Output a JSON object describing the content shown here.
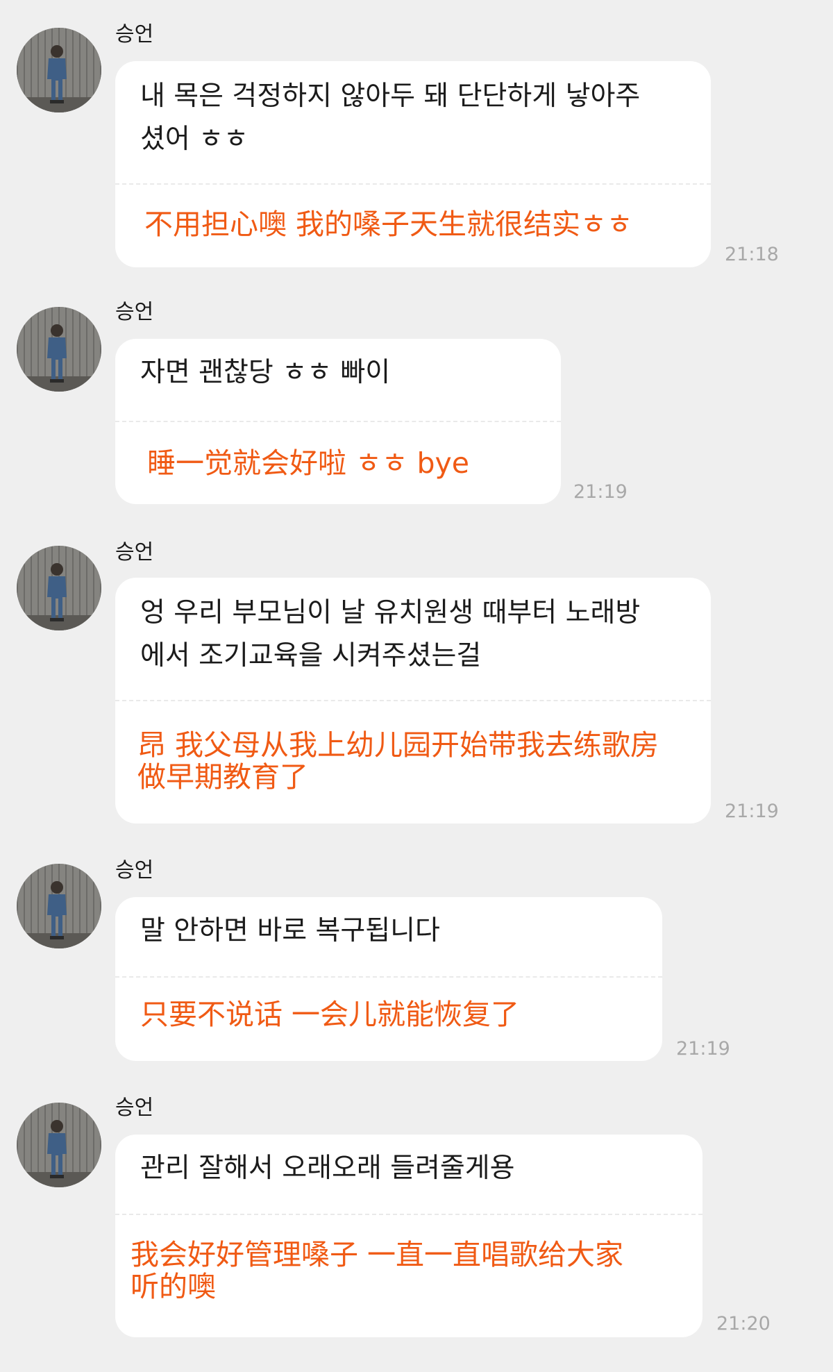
{
  "colors": {
    "background": "#efefef",
    "bubble": "#ffffff",
    "original_text": "#1b1b1b",
    "translation_text": "#f05a14",
    "timestamp": "#a8a8a8"
  },
  "messages": [
    {
      "sender": "승언",
      "avatar": "avatar-photo",
      "original": "내 목은 걱정하지 않아두 돼 단단하게 낳아주\n셨어 ㅎㅎ",
      "translation": "不用担心噢 我的嗓子天生就很结实ㅎㅎ",
      "time": "21:18"
    },
    {
      "sender": "승언",
      "avatar": "avatar-photo",
      "original": "자면 괜찮당 ㅎㅎ 빠이",
      "translation": "睡一觉就会好啦 ㅎㅎ bye",
      "time": "21:19"
    },
    {
      "sender": "승언",
      "avatar": "avatar-photo",
      "original": "엉 우리 부모님이 날 유치원생 때부터 노래방\n에서 조기교육을 시켜주셨는걸",
      "translation": "昂 我父母从我上幼儿园开始带我去练歌房\n做早期教育了",
      "time": "21:19"
    },
    {
      "sender": "승언",
      "avatar": "avatar-photo",
      "original": "말 안하면 바로 복구됩니다",
      "translation": "只要不说话 一会儿就能恢复了",
      "time": "21:19"
    },
    {
      "sender": "승언",
      "avatar": "avatar-photo",
      "original": "관리 잘해서 오래오래 들려줄게용",
      "translation": "我会好好管理嗓子 一直一直唱歌给大家\n听的噢",
      "time": "21:20"
    }
  ]
}
